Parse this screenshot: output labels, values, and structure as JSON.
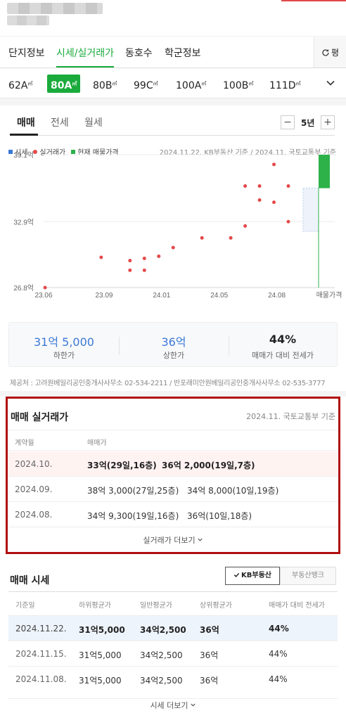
{
  "nav": {
    "tabs": [
      "단지정보",
      "시세/실거래가",
      "동호수",
      "학군정보"
    ],
    "active_tab": 1,
    "pyeong_label": "평"
  },
  "sizes": {
    "items": [
      {
        "num": "62A",
        "unit": "㎡"
      },
      {
        "num": "80A",
        "unit": "㎡"
      },
      {
        "num": "80B",
        "unit": "㎡"
      },
      {
        "num": "99C",
        "unit": "㎡"
      },
      {
        "num": "100A",
        "unit": "㎡"
      },
      {
        "num": "100B",
        "unit": "㎡"
      },
      {
        "num": "111D",
        "unit": "㎡"
      }
    ],
    "active": 1
  },
  "deal_tabs": {
    "tabs": [
      "매매",
      "전세",
      "월세"
    ],
    "active": 0,
    "minus": "−",
    "plus": "+",
    "period": "5년"
  },
  "legend": {
    "items": [
      "시세",
      "실거래가",
      "현재 매물가격"
    ],
    "colors": [
      "#3b79d6",
      "#e44a4a",
      "#2db24a"
    ],
    "source": "2024.11.22. KB부동산 기준 / 2024.11. 국토교통부 기준"
  },
  "chart_data": {
    "type": "scatter",
    "x_tick_labels": [
      "23.06",
      "23.09",
      "24.01",
      "24.05",
      "24.08",
      "매물가격"
    ],
    "y_tick_labels": [
      "39.1억",
      "32.9억",
      "26.8억"
    ],
    "ylim": [
      26.8,
      39.1
    ],
    "actual_trades": [
      {
        "x": 0.05,
        "y": 26.8
      },
      {
        "x": 2.0,
        "y": 29.6
      },
      {
        "x": 3.0,
        "y": 29.3
      },
      {
        "x": 3.0,
        "y": 28.4
      },
      {
        "x": 3.5,
        "y": 29.5
      },
      {
        "x": 3.5,
        "y": 28.4
      },
      {
        "x": 4.0,
        "y": 29.7
      },
      {
        "x": 4.5,
        "y": 30.5
      },
      {
        "x": 5.5,
        "y": 31.4
      },
      {
        "x": 6.5,
        "y": 31.4
      },
      {
        "x": 7.0,
        "y": 32.5
      },
      {
        "x": 7.0,
        "y": 36.2
      },
      {
        "x": 7.5,
        "y": 36.2
      },
      {
        "x": 7.5,
        "y": 34.9
      },
      {
        "x": 8.0,
        "y": 34.7
      },
      {
        "x": 8.0,
        "y": 38.2
      },
      {
        "x": 8.5,
        "y": 36.2
      },
      {
        "x": 8.5,
        "y": 32.9
      }
    ],
    "kb_price_range": [
      32.0,
      36.0
    ],
    "current_listing_range": [
      36.0,
      39.1
    ]
  },
  "summary": {
    "low_value": "31억 5,000",
    "low_label": "하한가",
    "high_value": "36억",
    "high_label": "상한가",
    "ratio_value": "44%",
    "ratio_label": "매매가 대비 전세가"
  },
  "provider": "제공처 : 고려원베일리공인중개사사무소 02-534-2211 / 반포래미안원베일리공인중개사사무소 02-535-3777",
  "trade_section": {
    "title": "매매 실거래가",
    "source": "2024.11. 국토교통부 기준",
    "col_month": "계약월",
    "col_price": "매매가",
    "rows": [
      {
        "month": "2024.10.",
        "deals": [
          "33억(29일,16층)",
          "36억 2,000(19일,7층)"
        ]
      },
      {
        "month": "2024.09.",
        "deals": [
          "38억 3,000(27일,25층)",
          "34억 8,000(10일,19층)"
        ]
      },
      {
        "month": "2024.08.",
        "deals": [
          "34억 9,300(19일,16층)",
          "36억(10일,18층)"
        ]
      }
    ],
    "more": "실거래가 더보기"
  },
  "market_section": {
    "title": "매매 시세",
    "btn_kb": "KB부동산",
    "btn_other": "부동산뱅크",
    "columns": [
      "기준일",
      "하위평균가",
      "일반평균가",
      "상위평균가",
      "매매가 대비 전세가"
    ],
    "rows": [
      [
        "2024.11.22.",
        "31억5,000",
        "34억2,500",
        "36억",
        "44%"
      ],
      [
        "2024.11.15.",
        "31억5,000",
        "34억2,500",
        "36억",
        "44%"
      ],
      [
        "2024.11.08.",
        "31억5,000",
        "34억2,500",
        "36억",
        "44%"
      ]
    ],
    "more": "시세 더보기"
  }
}
